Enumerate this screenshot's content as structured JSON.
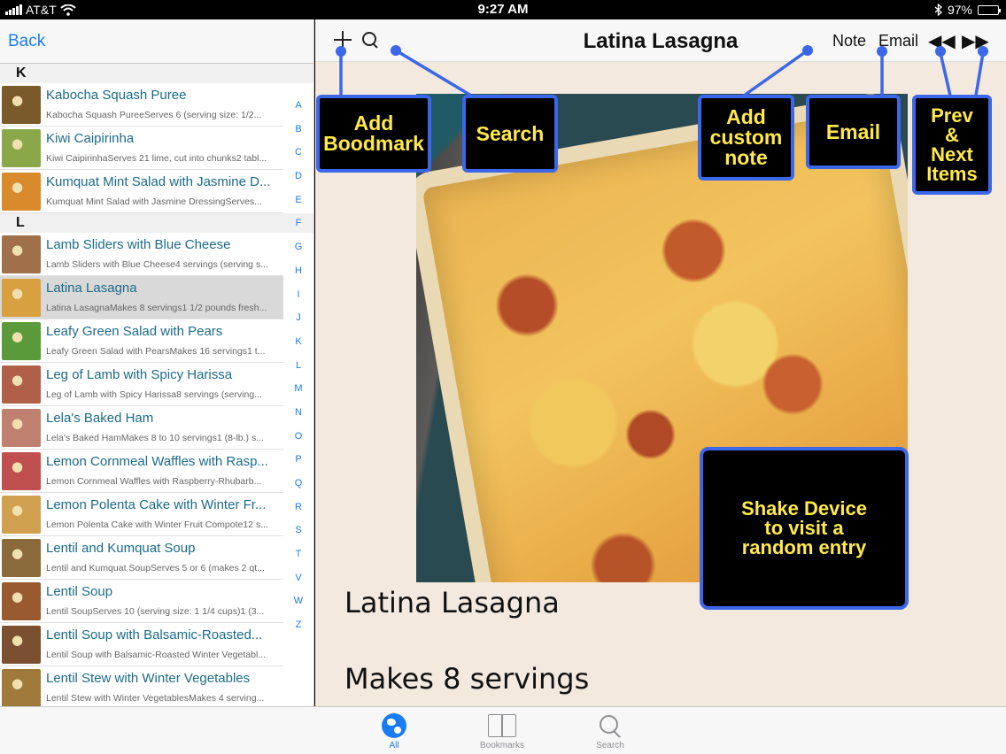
{
  "status_bar": {
    "carrier": "AT&T",
    "time": "9:27 AM",
    "battery": "97%",
    "battery_level": 0.97
  },
  "master": {
    "back_label": "Back",
    "sections": [
      {
        "letter": "K",
        "items": [
          {
            "title": "Kabocha Squash Puree",
            "subtitle": "Kabocha Squash PureeServes 6 (serving size: 1/2...",
            "thumb_color": "#7a5a2a"
          },
          {
            "title": "Kiwi Caipirinha",
            "subtitle": "Kiwi CaipirinhaServes 21 lime, cut into chunks2 tabl...",
            "thumb_color": "#8aa84a"
          },
          {
            "title": "Kumquat Mint Salad with Jasmine D...",
            "subtitle": "Kumquat Mint Salad with Jasmine DressingServes...",
            "thumb_color": "#d98a2a"
          }
        ]
      },
      {
        "letter": "L",
        "items": [
          {
            "title": "Lamb Sliders with Blue Cheese",
            "subtitle": "Lamb Sliders with Blue Cheese4 servings (serving s...",
            "thumb_color": "#a0704a"
          },
          {
            "title": "Latina Lasagna",
            "subtitle": "Latina LasagnaMakes 8 servings1 1/2 pounds fresh...",
            "thumb_color": "#d9a040",
            "selected": true
          },
          {
            "title": "Leafy Green Salad with Pears",
            "subtitle": "Leafy Green Salad with PearsMakes 16 servings1 t...",
            "thumb_color": "#5a9a3a"
          },
          {
            "title": "Leg of Lamb with Spicy Harissa",
            "subtitle": "Leg of Lamb with Spicy Harissa8 servings (serving...",
            "thumb_color": "#b06048"
          },
          {
            "title": "Lela's Baked Ham",
            "subtitle": "Lela's Baked HamMakes 8 to 10 servings1 (8-lb.) s...",
            "thumb_color": "#c08070"
          },
          {
            "title": "Lemon Cornmeal Waffles with Rasp...",
            "subtitle": "Lemon Cornmeal Waffles with Raspberry-Rhubarb...",
            "thumb_color": "#c05050"
          },
          {
            "title": "Lemon Polenta Cake with Winter Fr...",
            "subtitle": "Lemon Polenta Cake with Winter Fruit Compote12 s...",
            "thumb_color": "#d0a050"
          },
          {
            "title": "Lentil and Kumquat Soup",
            "subtitle": "Lentil and Kumquat SoupServes 5 or 6 (makes 2 qt...",
            "thumb_color": "#8a6a3a"
          },
          {
            "title": "Lentil Soup",
            "subtitle": "Lentil SoupServes 10 (serving size: 1 1/4 cups)1 (3...",
            "thumb_color": "#9a5a30"
          },
          {
            "title": "Lentil Soup with Balsamic-Roasted...",
            "subtitle": "Lentil Soup with Balsamic-Roasted Winter Vegetabl...",
            "thumb_color": "#7a5030"
          },
          {
            "title": "Lentil Stew with Winter Vegetables",
            "subtitle": "Lentil Stew with Winter VegetablesMakes 4 serving...",
            "thumb_color": "#a07a3a"
          }
        ]
      }
    ],
    "index_letters": [
      "A",
      "B",
      "C",
      "D",
      "E",
      "F",
      "G",
      "H",
      "I",
      "J",
      "K",
      "L",
      "M",
      "N",
      "O",
      "P",
      "Q",
      "R",
      "S",
      "T",
      "V",
      "W",
      "Z"
    ]
  },
  "detail": {
    "nav_title": "Latina Lasagna",
    "note_label": "Note",
    "email_label": "Email",
    "prev_label": "◀◀",
    "next_label": "▶▶",
    "recipe_title": "Latina Lasagna",
    "servings": "Makes 8 servings"
  },
  "callouts": {
    "bookmark": [
      "Add",
      "Boodmark"
    ],
    "search": [
      "Search"
    ],
    "note": [
      "Add",
      "custom",
      "note"
    ],
    "email": [
      "Email"
    ],
    "prevnext": [
      "Prev",
      "&",
      "Next",
      "Items"
    ],
    "shake": [
      "Shake Device",
      "to visit a",
      "random entry"
    ]
  },
  "tabbar": {
    "tabs": [
      {
        "label": "All",
        "active": true
      },
      {
        "label": "Bookmarks",
        "active": false
      },
      {
        "label": "Search",
        "active": false
      }
    ]
  },
  "colors": {
    "accent": "#1a7cf5",
    "callout_border": "#3b67e8",
    "callout_text": "#ffe94a",
    "detail_bg": "#f4e9df"
  }
}
